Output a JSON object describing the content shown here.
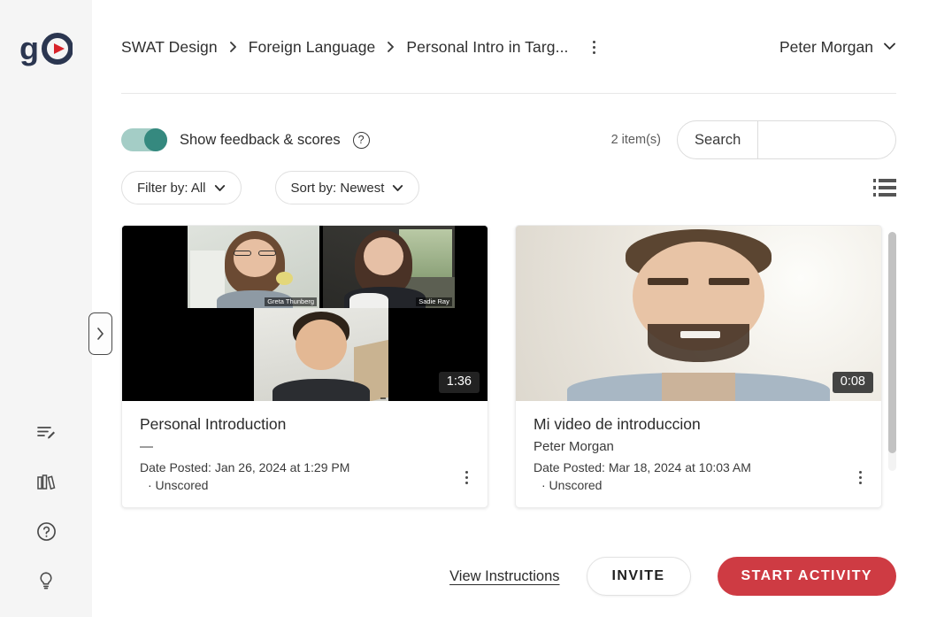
{
  "brand": {
    "logo_text": "go",
    "logo_color": "#2b3650",
    "accent_color": "#ce3b43"
  },
  "header": {
    "breadcrumb": [
      {
        "label": "SWAT Design"
      },
      {
        "label": "Foreign Language"
      },
      {
        "label": "Personal Intro in Targ..."
      }
    ],
    "separator": "›",
    "overflow_menu_name": "breadcrumb-overflow-menu",
    "user": {
      "name": "Peter Morgan",
      "chevron": "˅"
    }
  },
  "toolbar": {
    "toggle": {
      "label": "Show feedback & scores",
      "state": "on",
      "track_color": "#a4cdc6",
      "knob_color": "#35897f"
    },
    "help_glyph": "?",
    "item_count": "2 item(s)",
    "search": {
      "button_label": "Search",
      "value": "",
      "placeholder": ""
    },
    "filter": {
      "label": "Filter by: All",
      "chevron": "˅"
    },
    "sort": {
      "label": "Sort by: Newest",
      "chevron": "˅"
    },
    "view_toggle_name": "list-view-toggle"
  },
  "cards": [
    {
      "title": "Personal Introduction",
      "author": "—",
      "date": "Date Posted: Jan 26, 2024 at 1:29 PM",
      "score": "· Unscored",
      "duration": "1:36",
      "thumbnail_type": "video-conference-grid",
      "participants": [
        "Greta Thunberg",
        "Sadie Ray",
        ""
      ]
    },
    {
      "title": "Mi video de introduccion",
      "author": "Peter Morgan",
      "date": "Date Posted: Mar 18, 2024 at 10:03 AM",
      "score": "· Unscored",
      "duration": "0:08",
      "thumbnail_type": "single-speaker",
      "participants": []
    }
  ],
  "footer": {
    "instructions_link": "View Instructions",
    "invite_label": "INVITE",
    "start_label": "START ACTIVITY"
  },
  "rail": {
    "icons": [
      {
        "name": "notes-edit-icon"
      },
      {
        "name": "library-books-icon"
      },
      {
        "name": "help-circle-icon"
      },
      {
        "name": "lightbulb-icon"
      }
    ],
    "collapse_glyph": "›"
  }
}
